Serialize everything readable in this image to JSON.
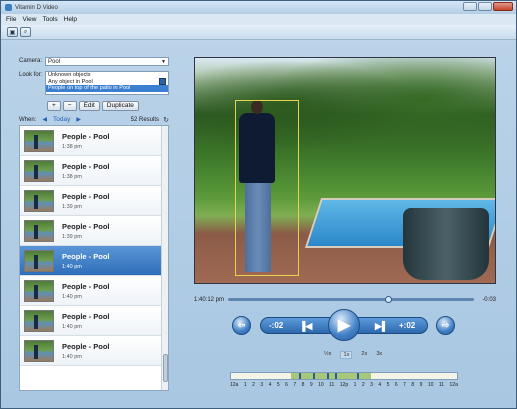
{
  "window": {
    "title": "Vitamin D Video"
  },
  "menu": [
    "File",
    "View",
    "Tools",
    "Help"
  ],
  "left": {
    "camera_label": "Camera:",
    "camera_value": "Pool",
    "lookfor_label": "Look for:",
    "lookfor_items": [
      "Unknown objects",
      "Any object in Pool",
      "People on top of the patio in Pool"
    ],
    "add_label": "+",
    "remove_label": "−",
    "edit_label": "Edit",
    "duplicate_label": "Duplicate",
    "when_label": "When:",
    "when_value": "Today",
    "results": "52 Results"
  },
  "results": [
    {
      "name": "People - Pool",
      "time": "1:38 pm"
    },
    {
      "name": "People - Pool",
      "time": "1:38 pm"
    },
    {
      "name": "People - Pool",
      "time": "1:39 pm"
    },
    {
      "name": "People - Pool",
      "time": "1:39 pm"
    },
    {
      "name": "People - Pool",
      "time": "1:40 pm"
    },
    {
      "name": "People - Pool",
      "time": "1:40 pm"
    },
    {
      "name": "People - Pool",
      "time": "1:40 pm"
    },
    {
      "name": "People - Pool",
      "time": "1:40 pm"
    }
  ],
  "player": {
    "current_time": "1:40:12 pm",
    "remaining": "-0:03",
    "back_label": "-:02",
    "fwd_label": "+:02",
    "speeds": [
      "1x",
      "2x",
      "3x"
    ],
    "speed_half": "½x",
    "timeline_labels": [
      "12a",
      "1",
      "2",
      "3",
      "4",
      "5",
      "6",
      "7",
      "8",
      "9",
      "10",
      "11",
      "12p",
      "1",
      "2",
      "3",
      "4",
      "5",
      "6",
      "7",
      "8",
      "9",
      "10",
      "11",
      "12a"
    ]
  },
  "progress": {
    "seek_fraction": 0.65
  }
}
